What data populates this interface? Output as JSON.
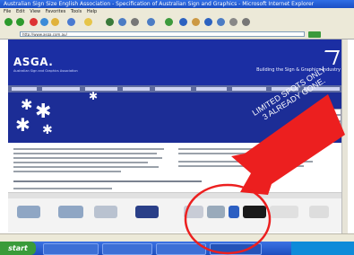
{
  "browser": {
    "title_text": "Australian Sign Size English Association - Specification of Australian Sign and Graphics - Microsoft Internet Explorer",
    "menu": [
      "File",
      "Edit",
      "View",
      "Favorites",
      "Tools",
      "Help"
    ],
    "address": "http://www.asga.com.au/",
    "status_text": ""
  },
  "site": {
    "logo_text": "ASGA.",
    "logo_subtitle": "Australian Sign and Graphics Association",
    "tagline": "Building the Sign & Graphics Industry"
  },
  "overlay": {
    "promo_line1": "LIMITED SPOTS ONLY",
    "promo_line2": "3 ALREADY GONE.",
    "arrow_color": "#ec1f1f",
    "circle_color": "#ec1f1f"
  },
  "taskbar": {
    "start_label": "start"
  },
  "colors": {
    "banner": "#1b2ea3",
    "hero": "#1c2d96"
  }
}
